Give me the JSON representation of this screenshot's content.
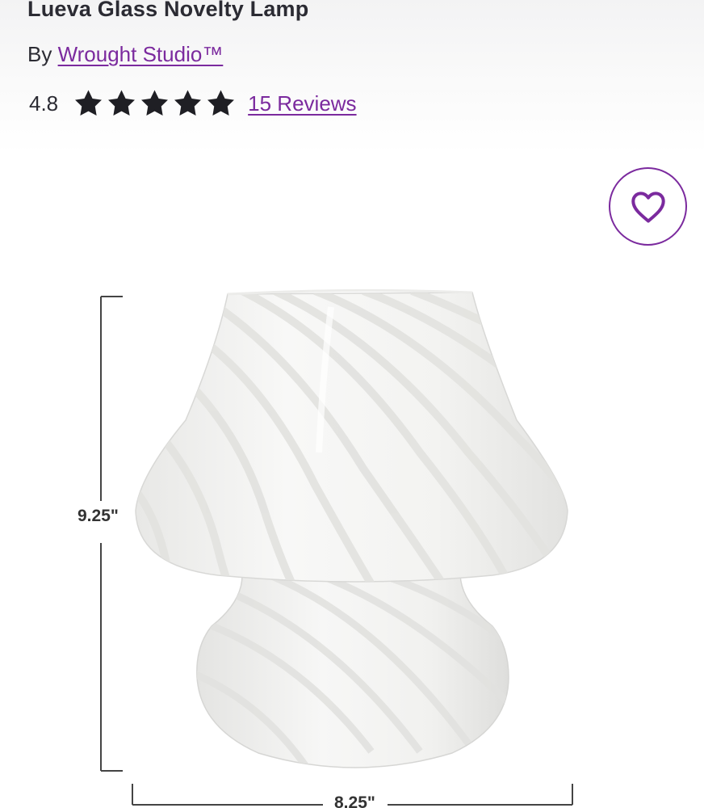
{
  "product": {
    "title": "Lueva Glass Novelty Lamp",
    "by_prefix": "By",
    "brand": "Wrought Studio™",
    "rating": "4.8",
    "star_count": 5,
    "rating_fraction": 0.96,
    "reviews_label": "15 Reviews"
  },
  "favorite": {
    "icon": "heart-icon"
  },
  "image": {
    "height_label": "9.25\"",
    "width_label": "8.25\""
  },
  "colors": {
    "brand_purple": "#7b2a9e",
    "text_dark": "#2b2b33",
    "star": "#1f1f24"
  }
}
